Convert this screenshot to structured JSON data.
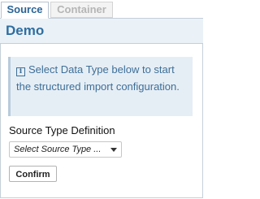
{
  "tabs": [
    {
      "label": "Source",
      "active": true
    },
    {
      "label": "Container",
      "active": false
    }
  ],
  "header": {
    "title": "Demo"
  },
  "info": {
    "icon": "info-icon",
    "message": "Select Data Type below to start the structured import configuration."
  },
  "form": {
    "section_label": "Source Type Definition",
    "select_value": "Select Source Type ...",
    "confirm_label": "Confirm"
  },
  "colors": {
    "accent": "#2f6fa0",
    "info_bg": "#e6eef5",
    "header_bg": "#eaf1f7"
  }
}
